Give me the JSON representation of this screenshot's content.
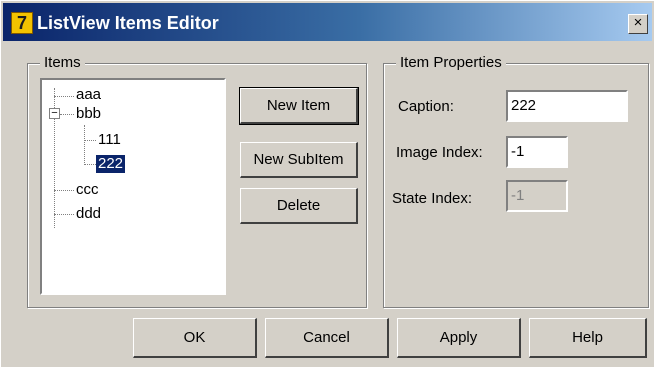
{
  "window": {
    "title": "ListView Items Editor",
    "close_label": "×",
    "icon_glyph": "7"
  },
  "items_group": {
    "title": "Items",
    "tree": [
      {
        "label": "aaa"
      },
      {
        "label": "bbb",
        "expanded": true,
        "expander": "−"
      },
      {
        "label": "111"
      },
      {
        "label": "222",
        "selected": true
      },
      {
        "label": "ccc"
      },
      {
        "label": "ddd"
      }
    ],
    "buttons": {
      "new_item": "New Item",
      "new_subitem": "New SubItem",
      "delete": "Delete"
    }
  },
  "properties_group": {
    "title": "Item Properties",
    "caption_label": "Caption:",
    "caption_value": "222",
    "image_index_label": "Image Index:",
    "image_index_value": "-1",
    "state_index_label": "State Index:",
    "state_index_value": "-1"
  },
  "footer": {
    "ok": "OK",
    "cancel": "Cancel",
    "apply": "Apply",
    "help": "Help"
  },
  "colors": {
    "titlebar_start": "#0a246a",
    "titlebar_end": "#a6caf0",
    "dialog_bg": "#d4d0c8",
    "selection": "#0a246a"
  }
}
